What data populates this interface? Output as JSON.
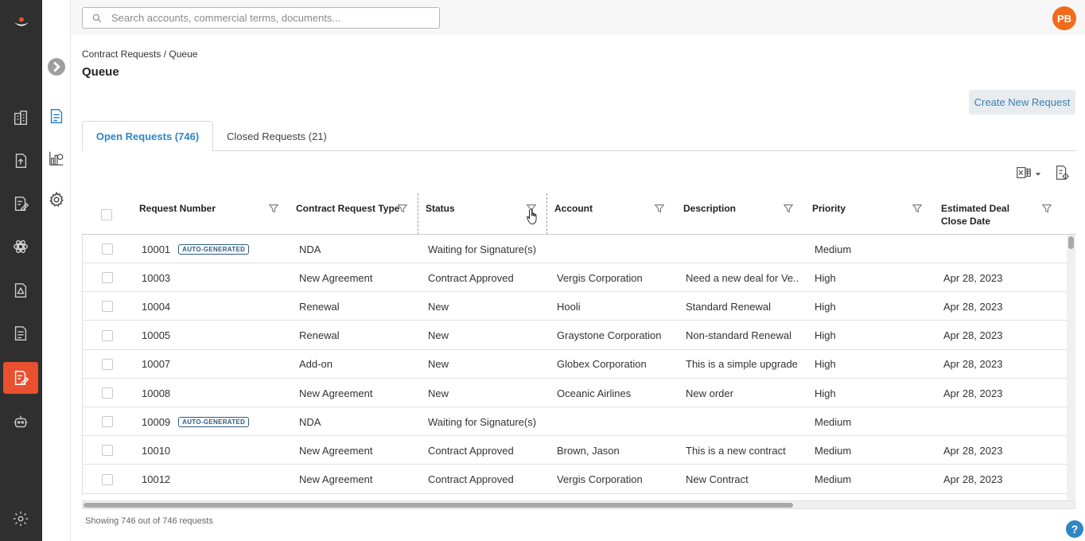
{
  "topbar": {
    "search_placeholder": "Search accounts, commercial terms, documents...",
    "avatar_initials": "PB"
  },
  "rail": {
    "icons": [
      "logo",
      "accounts-icon",
      "upload-icon",
      "contracts-edit-icon",
      "integrations-icon",
      "document-alert-icon",
      "document-list-icon",
      "contract-requests-icon",
      "bot-icon",
      "settings-icon"
    ],
    "active": "contract-requests-icon",
    "accent_color": "#e8502f"
  },
  "header": {
    "breadcrumb": "Contract Requests / Queue",
    "title": "Queue",
    "create_button": "Create New Request"
  },
  "tabs": [
    {
      "label": "Open Requests (746)",
      "active": true
    },
    {
      "label": "Closed Requests (21)",
      "active": false
    }
  ],
  "table": {
    "columns": [
      "Request Number",
      "Contract Request Type",
      "Status",
      "Account",
      "Description",
      "Priority",
      "Estimated Deal Close Date"
    ],
    "badge_label": "AUTO-GENERATED",
    "rows": [
      {
        "number": "10001",
        "badge": true,
        "type": "NDA",
        "status": "Waiting for Signature(s)",
        "account": "",
        "description": "",
        "priority": "Medium",
        "close_date": ""
      },
      {
        "number": "10003",
        "badge": false,
        "type": "New Agreement",
        "status": "Contract Approved",
        "account": "Vergis Corporation",
        "description": "Need a new deal for Ve...",
        "priority": "High",
        "close_date": "Apr 28, 2023"
      },
      {
        "number": "10004",
        "badge": false,
        "type": "Renewal",
        "status": "New",
        "account": "Hooli",
        "description": "Standard Renewal",
        "priority": "High",
        "close_date": "Apr 28, 2023"
      },
      {
        "number": "10005",
        "badge": false,
        "type": "Renewal",
        "status": "New",
        "account": "Graystone Corporation",
        "description": "Non-standard Renewal",
        "priority": "High",
        "close_date": "Apr 28, 2023"
      },
      {
        "number": "10007",
        "badge": false,
        "type": "Add-on",
        "status": "New",
        "account": "Globex Corporation",
        "description": "This is a simple upgrade",
        "priority": "High",
        "close_date": "Apr 28, 2023"
      },
      {
        "number": "10008",
        "badge": false,
        "type": "New Agreement",
        "status": "New",
        "account": "Oceanic Airlines",
        "description": "New order",
        "priority": "High",
        "close_date": "Apr 28, 2023"
      },
      {
        "number": "10009",
        "badge": true,
        "type": "NDA",
        "status": "Waiting for Signature(s)",
        "account": "",
        "description": "",
        "priority": "Medium",
        "close_date": ""
      },
      {
        "number": "10010",
        "badge": false,
        "type": "New Agreement",
        "status": "Contract Approved",
        "account": "Brown, Jason",
        "description": "This is a new contract",
        "priority": "Medium",
        "close_date": "Apr 28, 2023"
      },
      {
        "number": "10012",
        "badge": false,
        "type": "New Agreement",
        "status": "Contract Approved",
        "account": "Vergis Corporation",
        "description": "New Contract",
        "priority": "Medium",
        "close_date": "Apr 28, 2023"
      }
    ]
  },
  "footer": {
    "count_text": "Showing 746 out of 746 requests",
    "help_label": "?"
  }
}
